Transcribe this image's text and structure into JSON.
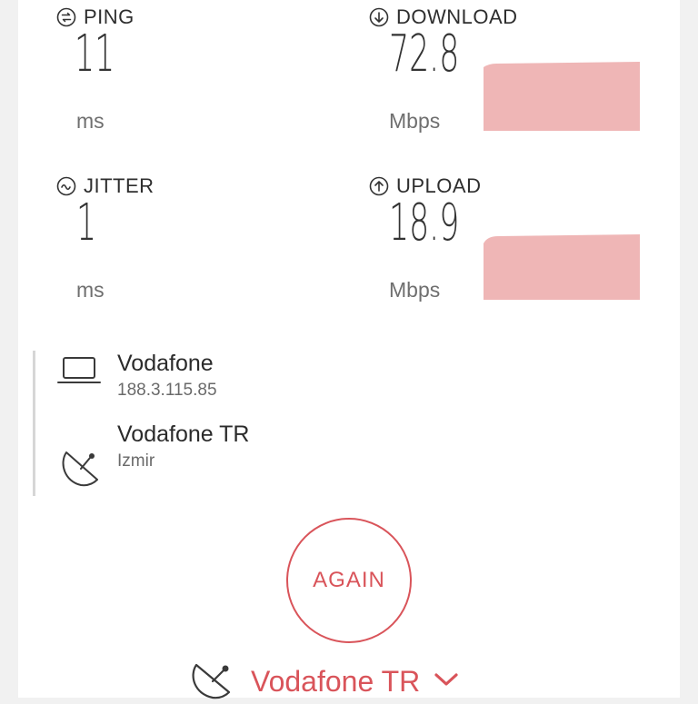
{
  "metrics": {
    "ping": {
      "label": "PING",
      "value": "11",
      "unit": "ms"
    },
    "download": {
      "label": "DOWNLOAD",
      "value": "72.8",
      "unit": "Mbps"
    },
    "jitter": {
      "label": "JITTER",
      "value": "1",
      "unit": "ms"
    },
    "upload": {
      "label": "UPLOAD",
      "value": "18.9",
      "unit": "Mbps"
    }
  },
  "client": {
    "isp": "Vodafone",
    "ip": "188.3.115.85",
    "icon": "laptop-icon"
  },
  "server": {
    "name": "Vodafone TR",
    "city": "Izmir",
    "icon": "satellite-dish-icon"
  },
  "actions": {
    "again_label": "AGAIN"
  },
  "provider_selector": {
    "selected": "Vodafone TR"
  },
  "colors": {
    "accent": "#d9545a",
    "graph_fill": "#efb6b6"
  }
}
